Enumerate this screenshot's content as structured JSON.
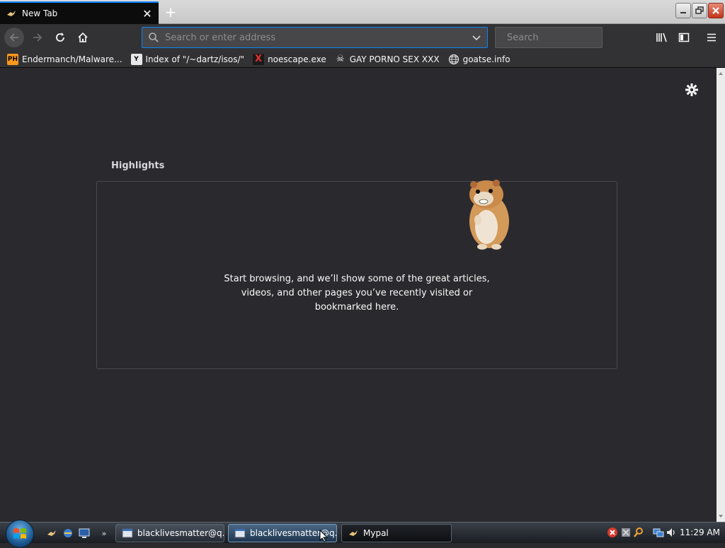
{
  "tab": {
    "title": "New Tab",
    "close_glyph": "✕",
    "new_glyph": "+"
  },
  "toolbar": {
    "url_placeholder": "Search or enter address",
    "search_placeholder": "Search"
  },
  "bookmarks": [
    {
      "label": "Endermanch/Malware...",
      "icon": "PH",
      "icon_name": "ph-icon"
    },
    {
      "label": "Index of \"/~dartz/isos/\"",
      "icon": "Y",
      "icon_name": "ycombinator-icon"
    },
    {
      "label": "noescape.exe",
      "icon": "X",
      "icon_name": "x-red-icon"
    },
    {
      "label": "GAY PORNO SEX XXX",
      "icon": "☠",
      "icon_name": "skull-icon"
    },
    {
      "label": "goatse.info",
      "icon": "🌐",
      "icon_name": "globe-icon"
    }
  ],
  "highlights": {
    "title": "Highlights",
    "message_lines": [
      "Start browsing, and we’ll show some of the great articles,",
      "videos, and other pages you’ve recently visited or",
      "bookmarked here."
    ]
  },
  "taskbar": {
    "buttons": [
      {
        "label": "blacklivesmatter@q...",
        "active": false
      },
      {
        "label": "blacklivesmatter@q...",
        "active": true
      },
      {
        "label": "Mypal",
        "active": false
      }
    ],
    "clock": "11:29 AM"
  },
  "colors": {
    "accent": "#0a84ff",
    "toolbar_bg": "#323234",
    "content_bg": "#2a2a2e",
    "tab_bg": "#0c0c0d"
  }
}
